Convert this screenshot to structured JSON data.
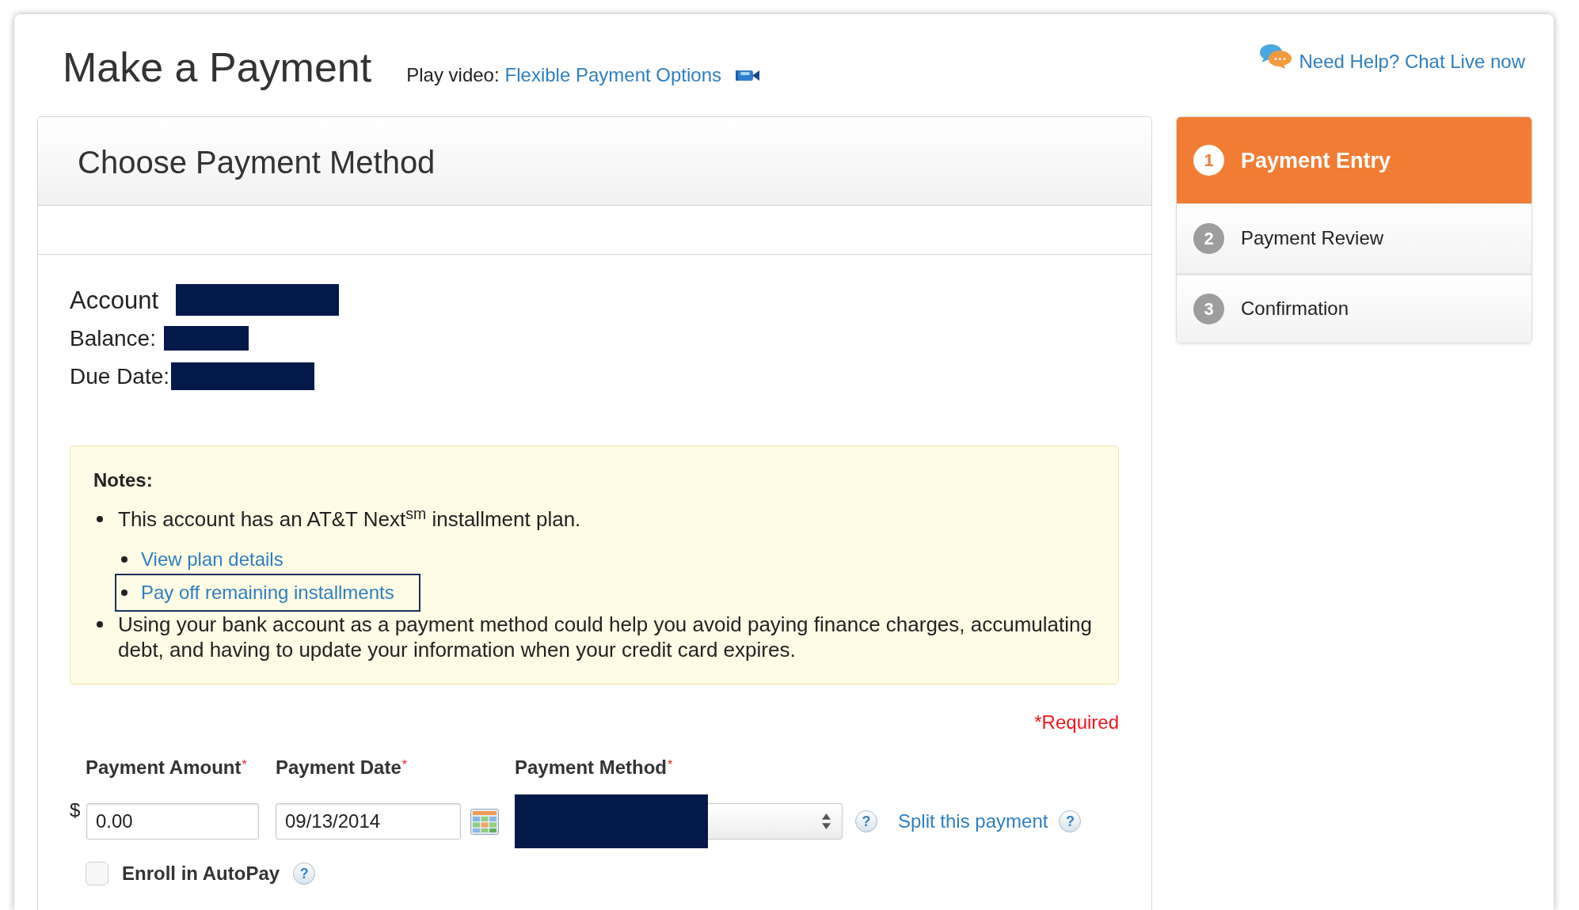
{
  "header": {
    "title": "Make a Payment",
    "video": {
      "label": "Play video:",
      "link": "Flexible Payment Options"
    },
    "help_link": "Need Help? Chat Live now"
  },
  "payment_card": {
    "title": "Choose Payment Method",
    "account_details": [
      {
        "kind": "heading",
        "label": "Account",
        "redacted": true
      },
      {
        "kind": "detail",
        "label": "Balance:",
        "redacted": true
      },
      {
        "kind": "detail",
        "label": "Due Date:",
        "redacted": true
      }
    ],
    "notes": {
      "title": "Notes:",
      "items": [
        {
          "text": "This account has an AT&T Next$^{sm}$ installment plan.",
          "links": [
            {
              "label": "View plan details",
              "focused": false
            },
            {
              "label": "Pay off remaining installments",
              "focused": true
            }
          ]
        },
        {
          "text": "Using your bank account as a payment method could help you avoid paying finance charges, accumulating debt, and having to update your information when your credit card expires."
        }
      ]
    },
    "form": {
      "required_note": "*Required",
      "fields": [
        {
          "kind": "amount",
          "label": "Payment Amount",
          "required_mark": "*",
          "prefix": "$",
          "value": "0.00"
        },
        {
          "kind": "date",
          "label": "Payment Date",
          "required_mark": "*",
          "value": "09/13/2014"
        },
        {
          "kind": "select",
          "label": "Payment Method",
          "required_mark": "*",
          "redacted": true,
          "help": "?"
        }
      ],
      "split_link": {
        "label": "Split this payment",
        "help": "?"
      },
      "autopay": {
        "label": "Enroll in AutoPay",
        "checked": false,
        "help": "?"
      }
    }
  },
  "steps": [
    {
      "number": "1",
      "label": "Payment Entry",
      "selected": true
    },
    {
      "number": "2",
      "label": "Payment Review",
      "selected": false
    },
    {
      "number": "3",
      "label": "Confirmation",
      "selected": false
    }
  ]
}
